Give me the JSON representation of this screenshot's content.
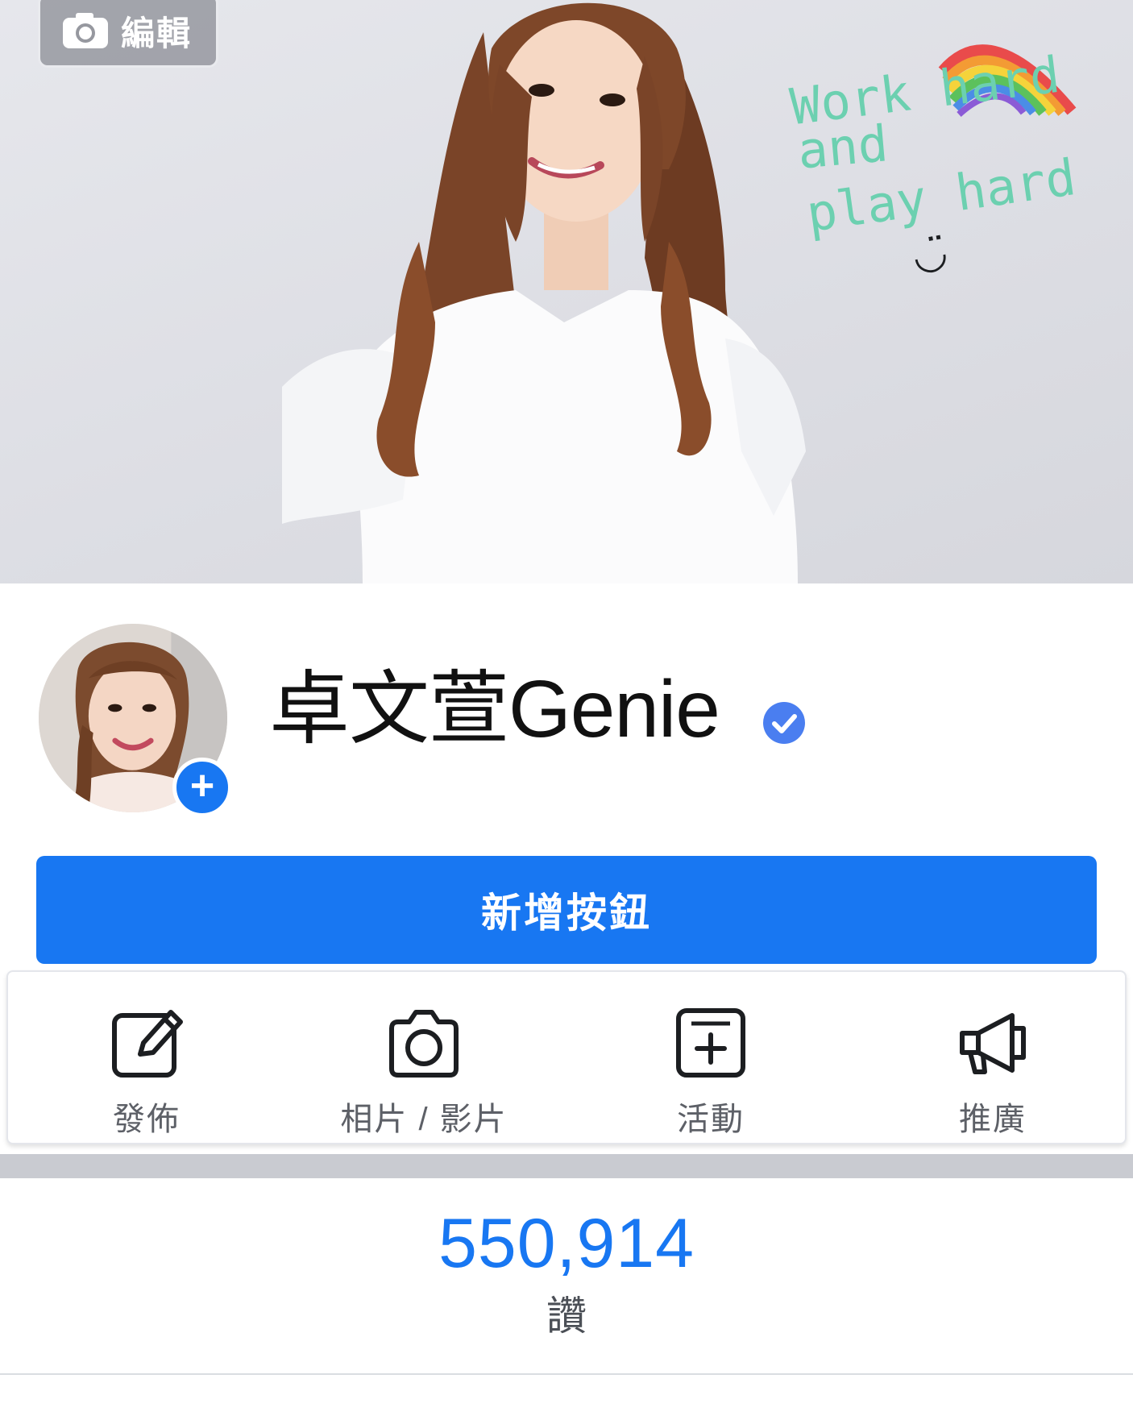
{
  "cover": {
    "edit_label": "編輯",
    "overlay_text": [
      "Work hard",
      "and",
      "play hard"
    ],
    "overlay_emoticon": "◡̈"
  },
  "profile": {
    "name": "卓文萱Genie",
    "verified": true
  },
  "primary_button": {
    "label": "新增按鈕"
  },
  "actions": [
    {
      "label": "發佈",
      "icon": "compose-icon"
    },
    {
      "label": "相片 / 影片",
      "icon": "camera-icon"
    },
    {
      "label": "活動",
      "icon": "event-icon"
    },
    {
      "label": "推廣",
      "icon": "megaphone-icon"
    }
  ],
  "stats": {
    "likes_count": "550,914",
    "likes_label": "讚"
  },
  "colors": {
    "brand_blue": "#1877f2",
    "overlay_text": "#6cd0b0",
    "separator": "#c9cbd1"
  }
}
